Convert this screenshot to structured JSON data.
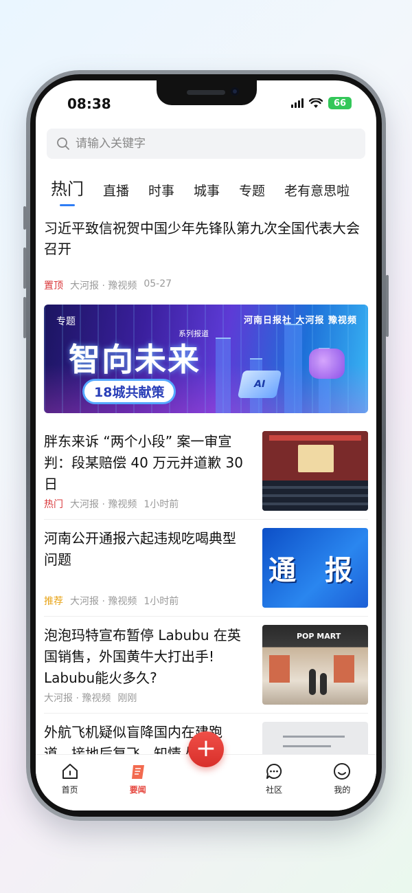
{
  "status": {
    "time": "08:38",
    "battery": "66"
  },
  "search": {
    "placeholder": "请输入关键字"
  },
  "tabs": [
    "热门",
    "直播",
    "时事",
    "城事",
    "专题",
    "老有意思啦"
  ],
  "top_story": {
    "title": "习近平致信祝贺中国少年先锋队第九次全国代表大会召开",
    "tag": "置顶",
    "source": "大河报 · 豫视频",
    "time": "05-27"
  },
  "banner": {
    "kicker": "专题",
    "series": "系列报道",
    "logos": "河南日报社  大河报  豫视频",
    "title": "智向未来",
    "subtitle": "18城共献策",
    "chip": "AI"
  },
  "news": [
    {
      "title": "胖东来诉 “两个小段” 案一审宣判：段某赔偿 40 万元并道歉 30日",
      "tag": "热门",
      "source": "大河报 · 豫视频",
      "time": "1小时前"
    },
    {
      "title": "河南公开通报六起违规吃喝典型问题",
      "tag": "推荐",
      "source": "大河报 · 豫视频",
      "time": "1小时前",
      "thumb_text": "通 报"
    },
    {
      "title": "泡泡玛特宣布暂停 Labubu 在英国销售，外国黄牛大打出手! Labubu能火多久?",
      "tag": "",
      "source": "大河报 · 豫视频",
      "time": "刚刚",
      "thumb_text": "POP MART"
    },
    {
      "title": "外航飞机疑似盲降国内在建跑道，接地后复飞，知情人：机",
      "tag": "",
      "source": "",
      "time": ""
    }
  ],
  "nav": [
    {
      "label": "首页",
      "icon": "home-icon"
    },
    {
      "label": "要闻",
      "icon": "news-icon"
    },
    {
      "label": "社区",
      "icon": "chat-icon"
    },
    {
      "label": "我的",
      "icon": "profile-icon"
    }
  ],
  "fab": {
    "symbol": "+"
  },
  "colors": {
    "accent": "#2f7df5",
    "red": "#d9383b",
    "gold": "#e8a418",
    "battery": "#33c759"
  }
}
